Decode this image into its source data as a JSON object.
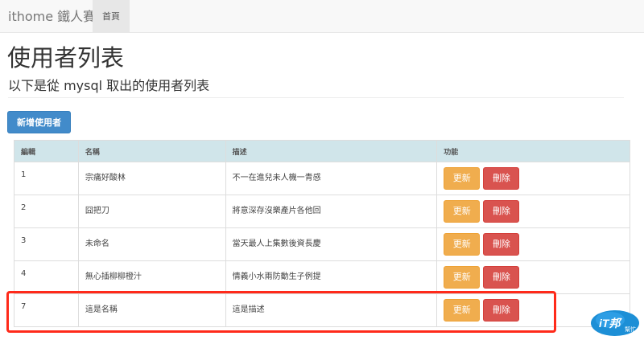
{
  "navbar": {
    "brand": "ithome 鐵人賽",
    "home": "首頁"
  },
  "page": {
    "title": "使用者列表",
    "subtitle": "以下是從 mysql 取出的使用者列表"
  },
  "add_button": "新增使用者",
  "table": {
    "headers": [
      "編輯",
      "名稱",
      "描述",
      "功能"
    ],
    "rows": [
      {
        "id": "1",
        "name": "宗痛好酸林",
        "desc": "不一在進兒未人機一青感",
        "update": "更新",
        "delete": "刪除"
      },
      {
        "id": "2",
        "name": "囧把刀",
        "desc": "將意深存沒樂產片各他回",
        "update": "更新",
        "delete": "刪除"
      },
      {
        "id": "3",
        "name": "未命名",
        "desc": "當天最人上集數後資長慶",
        "update": "更新",
        "delete": "刪除"
      },
      {
        "id": "4",
        "name": "無心插柳柳橙汁",
        "desc": "情義小水兩防動生子例提",
        "update": "更新",
        "delete": "刪除"
      },
      {
        "id": "7",
        "name": "這是名稱",
        "desc": "這是描述",
        "update": "更新",
        "delete": "刪除"
      }
    ]
  },
  "watermark": {
    "logo_text": "iT邦",
    "logo_sub": "幫忙"
  },
  "colors": {
    "primary": "#428bca",
    "warning": "#f0ad4e",
    "danger": "#d9534f",
    "table_header": "#d0e5ea",
    "highlight": "#ff2a1a"
  }
}
